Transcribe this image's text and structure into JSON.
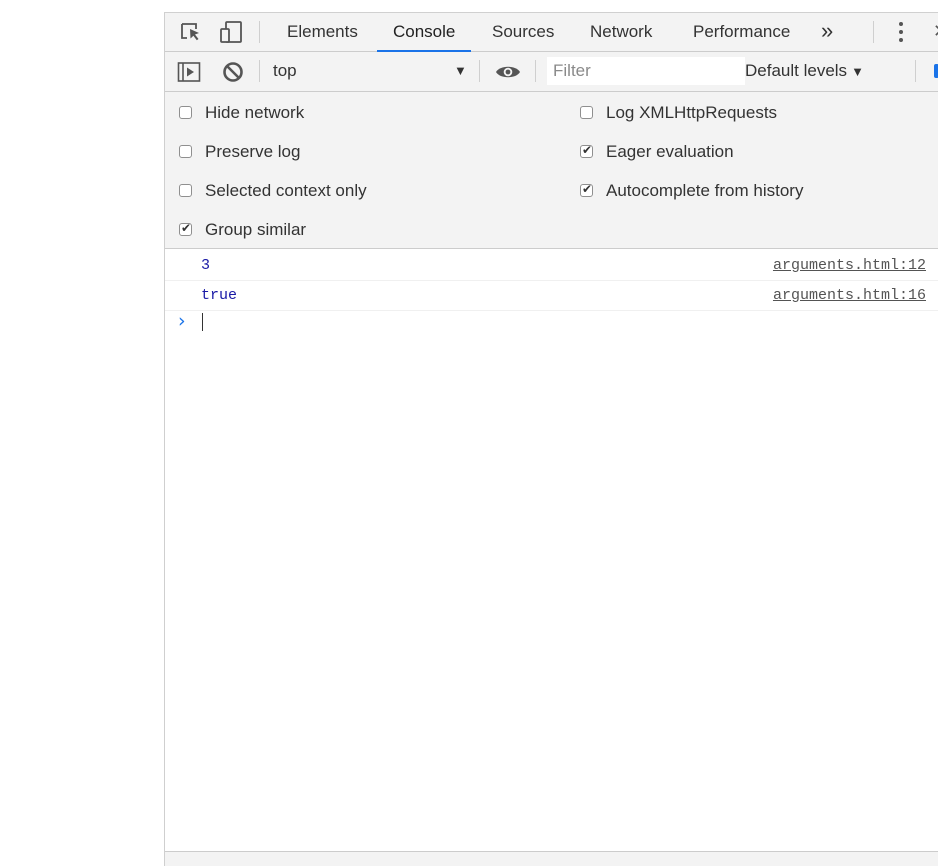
{
  "tabs": {
    "items": [
      {
        "label": "Elements"
      },
      {
        "label": "Console",
        "active": true
      },
      {
        "label": "Sources"
      },
      {
        "label": "Network"
      },
      {
        "label": "Performance"
      }
    ],
    "overflow_label": "»"
  },
  "toolbar": {
    "context": "top",
    "filter_placeholder": "Filter",
    "levels_label": "Default levels",
    "levels_arrow": "▼",
    "context_arrow": "▼"
  },
  "settings": [
    {
      "label": "Hide network",
      "checked": false
    },
    {
      "label": "Log XMLHttpRequests",
      "checked": false
    },
    {
      "label": "Preserve log",
      "checked": false
    },
    {
      "label": "Eager evaluation",
      "checked": true
    },
    {
      "label": "Selected context only",
      "checked": false
    },
    {
      "label": "Autocomplete from history",
      "checked": true
    },
    {
      "label": "Group similar",
      "checked": true
    }
  ],
  "messages": [
    {
      "value": "3",
      "source": "arguments.html:12"
    },
    {
      "value": "true",
      "source": "arguments.html:16"
    }
  ],
  "prompt": {
    "chevron": "›"
  },
  "icons": [
    "inspect-element-icon",
    "device-toolbar-icon",
    "show-sidebar-icon",
    "clear-console-icon",
    "live-expression-eye-icon",
    "more-options-icon",
    "close-icon"
  ],
  "colors": {
    "accent": "#1a73e8",
    "value_blue": "#1a1aa6",
    "toolbar_bg": "#f3f3f3"
  }
}
